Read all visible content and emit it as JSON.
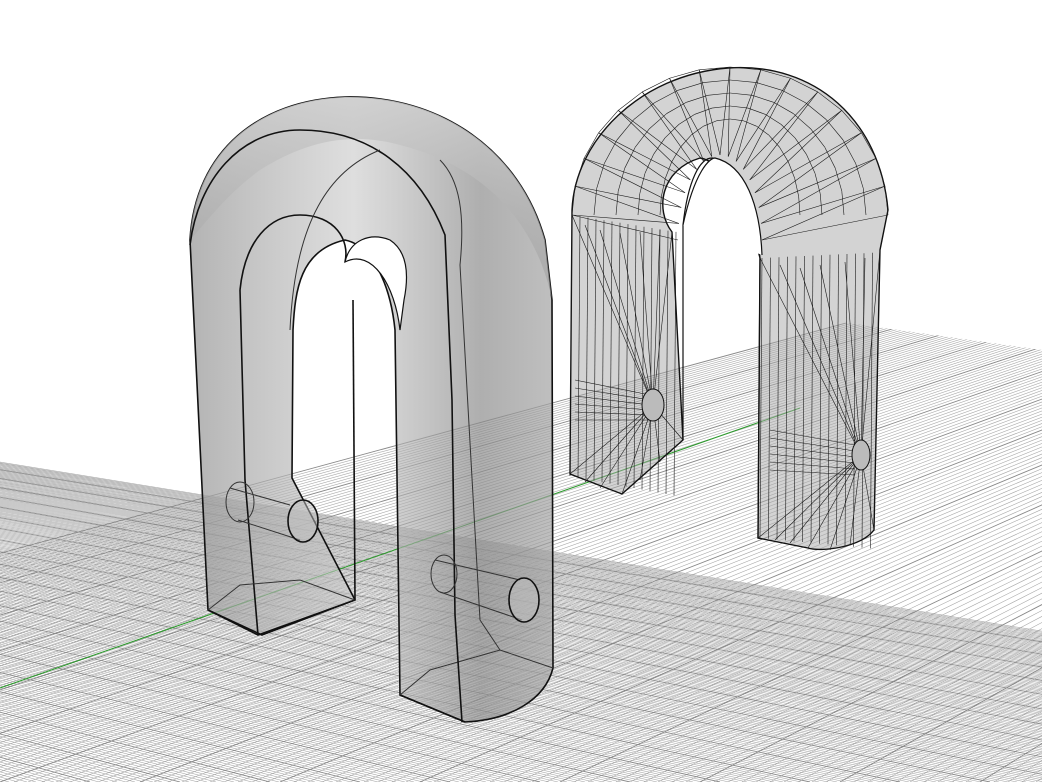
{
  "viewport": {
    "background": "#ffffff",
    "grid_color": "#9a9a9a",
    "axis_color": "#2e9a2e",
    "model_fill": "#9c9c9c",
    "model_edge": "#111111"
  },
  "objects": [
    {
      "kind": "smooth-u-bracket",
      "display": "shaded-ghosted"
    },
    {
      "kind": "meshed-u-bracket",
      "display": "wireframe-mesh"
    }
  ]
}
